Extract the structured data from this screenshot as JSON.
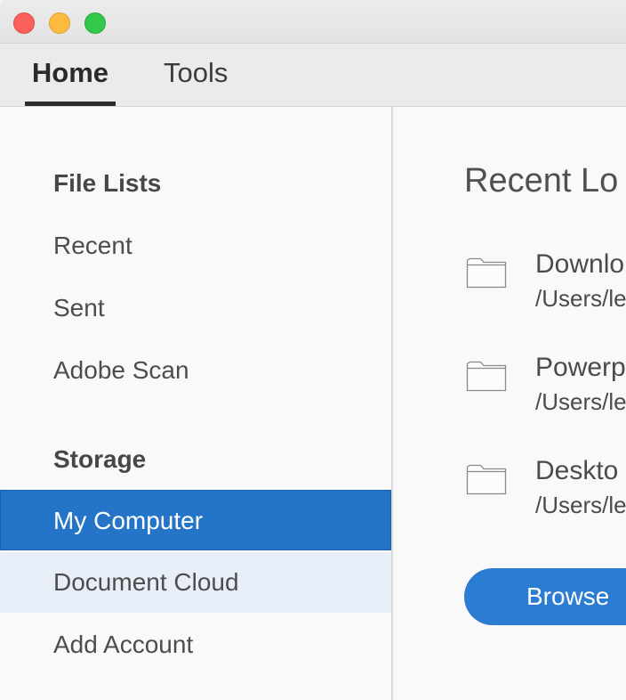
{
  "window": {
    "controls": [
      "close",
      "minimize",
      "zoom"
    ]
  },
  "tabs": [
    {
      "label": "Home",
      "active": true
    },
    {
      "label": "Tools",
      "active": false
    }
  ],
  "sidebar": {
    "file_lists_header": "File Lists",
    "file_lists": [
      "Recent",
      "Sent",
      "Adobe Scan"
    ],
    "storage_header": "Storage",
    "storage": [
      {
        "label": "My Computer",
        "state": "selected"
      },
      {
        "label": "Document Cloud",
        "state": "hover"
      },
      {
        "label": "Add Account",
        "state": "normal"
      }
    ]
  },
  "main": {
    "title": "Recent Lo",
    "locations": [
      {
        "name": "Downlo",
        "path": "/Users/le",
        "icon": "folder-icon"
      },
      {
        "name": "Powerp",
        "path": "/Users/le",
        "icon": "folder-icon"
      },
      {
        "name": "Deskto",
        "path": "/Users/le",
        "icon": "folder-icon"
      }
    ],
    "browse_label": "Browse"
  },
  "colors": {
    "accent": "#2474c8",
    "button": "#2b7dd3",
    "hover_row": "#e8eef8",
    "close": "#fc605c",
    "minimize": "#fcbb40",
    "zoom": "#34c84a"
  }
}
